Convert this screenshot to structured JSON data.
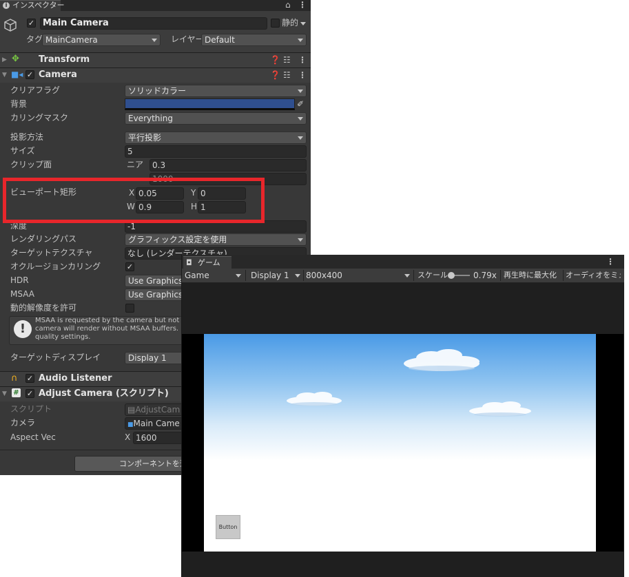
{
  "inspector": {
    "tab_label": "インスペクター",
    "object_name": "Main Camera",
    "static_label": "静的",
    "tag_label": "タグ",
    "tag_value": "MainCamera",
    "layer_label": "レイヤー",
    "layer_value": "Default",
    "transform_title": "Transform",
    "camera_title": "Camera",
    "fields": {
      "clear_flags_label": "クリアフラグ",
      "clear_flags_value": "ソリッドカラー",
      "background_label": "背景",
      "background_color": "#2f4f8f",
      "culling_mask_label": "カリングマスク",
      "culling_mask_value": "Everything",
      "projection_label": "投影方法",
      "projection_value": "平行投影",
      "size_label": "サイズ",
      "size_value": "5",
      "clip_label": "クリップ面",
      "near_label": "ニア",
      "near_value": "0.3",
      "far_value": "1000",
      "viewport_label": "ビューポート矩形",
      "vx_label": "X",
      "vx_value": "0.05",
      "vy_label": "Y",
      "vy_value": "0",
      "vw_label": "W",
      "vw_value": "0.9",
      "vh_label": "H",
      "vh_value": "1",
      "depth_label": "深度",
      "depth_value": "-1",
      "rendering_path_label": "レンダリングパス",
      "rendering_path_value": "グラフィックス設定を使用",
      "target_texture_label": "ターゲットテクスチャ",
      "target_texture_value": "なし (レンダーテクスチャ)",
      "occlusion_label": "オクルージョンカリング",
      "hdr_label": "HDR",
      "hdr_value": "Use Graphics",
      "msaa_label": "MSAA",
      "msaa_value": "Use Graphics",
      "dynamic_res_label": "動的解像度を許可",
      "warning_line1": "MSAA is requested by the camera but not e",
      "warning_line2": "camera will render without MSAA buffers. If",
      "warning_line3": "quality settings.",
      "target_display_label": "ターゲットディスプレイ",
      "target_display_value": "Display 1"
    },
    "audio_listener_title": "Audio Listener",
    "adjust_camera_title": "Adjust Camera (スクリプト)",
    "script_label": "スクリプト",
    "script_value": "AdjustCam",
    "camera_label": "カメラ",
    "camera_value": "Main Came",
    "aspect_label": "Aspect Vec",
    "aspect_x_label": "X",
    "aspect_x_value": "1600",
    "add_component_label": "コンポーネントを追加"
  },
  "game": {
    "tab_label": "ゲーム",
    "mode_value": "Game",
    "display_value": "Display 1",
    "resolution_value": "800x400",
    "scale_label": "スケール",
    "scale_value": "0.79x",
    "maximize_label": "再生時に最大化",
    "audio_label": "オーディオをミュー",
    "button_label": "Button"
  },
  "colors": {
    "highlight_border": "#e8262b",
    "panel_bg": "#383838",
    "sky_top": "#4a9ae6",
    "sky_bottom": "#ffffff"
  }
}
